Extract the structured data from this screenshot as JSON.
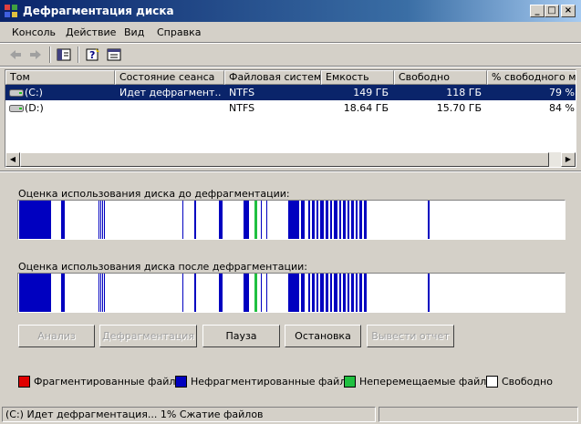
{
  "window": {
    "title": "Дефрагментация диска"
  },
  "menu": {
    "items": [
      "Консоль",
      "Действие",
      "Вид",
      "Справка"
    ]
  },
  "toolbar": {
    "icons": [
      "back-arrow-icon",
      "forward-arrow-icon",
      "show-hide-tree-icon",
      "help-icon",
      "properties-icon"
    ]
  },
  "volumes": {
    "columns": [
      "Том",
      "Состояние сеанса",
      "Файловая система",
      "Емкость",
      "Свободно",
      "% свободного мес"
    ],
    "rows": [
      {
        "volume": "(C:)",
        "status": "Идет дефрагмент...",
        "fs": "NTFS",
        "capacity": "149 ГБ",
        "free": "118 ГБ",
        "percent": "79 %",
        "selected": true
      },
      {
        "volume": "(D:)",
        "status": "",
        "fs": "NTFS",
        "capacity": "18.64 ГБ",
        "free": "15.70 ГБ",
        "percent": "84 %",
        "selected": false
      }
    ]
  },
  "analysis": {
    "before_label": "Оценка использования диска до дефрагментации:",
    "after_label": "Оценка использования диска после дефрагментации:"
  },
  "buttons": {
    "analyze": "Анализ",
    "defrag": "Дефрагментация",
    "pause": "Пауза",
    "stop": "Остановка",
    "report": "Вывести отчет"
  },
  "legend": {
    "fragmented": "Фрагментированные файлы",
    "contiguous": "Нефрагментированные файлы",
    "unmovable": "Неперемещаемые файлы",
    "free": "Свободно"
  },
  "colors": {
    "fragmented": "#e00000",
    "contiguous": "#0000c0",
    "unmovable": "#20c040",
    "free": "#ffffff",
    "selection": "#0a246a",
    "title_start": "#0a246a"
  },
  "status": {
    "text": "(C:) Идет дефрагментация... 1%  Сжатие файлов"
  }
}
